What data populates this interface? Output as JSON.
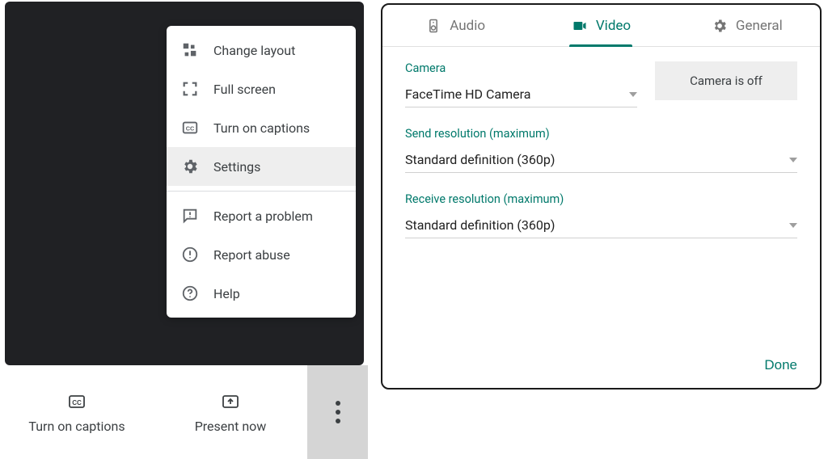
{
  "menu": {
    "items": [
      {
        "label": "Change layout"
      },
      {
        "label": "Full screen"
      },
      {
        "label": "Turn on captions"
      },
      {
        "label": "Settings"
      },
      {
        "label": "Report a problem"
      },
      {
        "label": "Report abuse"
      },
      {
        "label": "Help"
      }
    ]
  },
  "toolbar": {
    "captions_label": "Turn on captions",
    "present_label": "Present now"
  },
  "settings": {
    "tabs": {
      "audio": "Audio",
      "video": "Video",
      "general": "General"
    },
    "camera": {
      "label": "Camera",
      "value": "FaceTime HD Camera",
      "status": "Camera is off"
    },
    "send": {
      "label": "Send resolution (maximum)",
      "value": "Standard definition (360p)"
    },
    "receive": {
      "label": "Receive resolution (maximum)",
      "value": "Standard definition (360p)"
    },
    "done": "Done"
  }
}
